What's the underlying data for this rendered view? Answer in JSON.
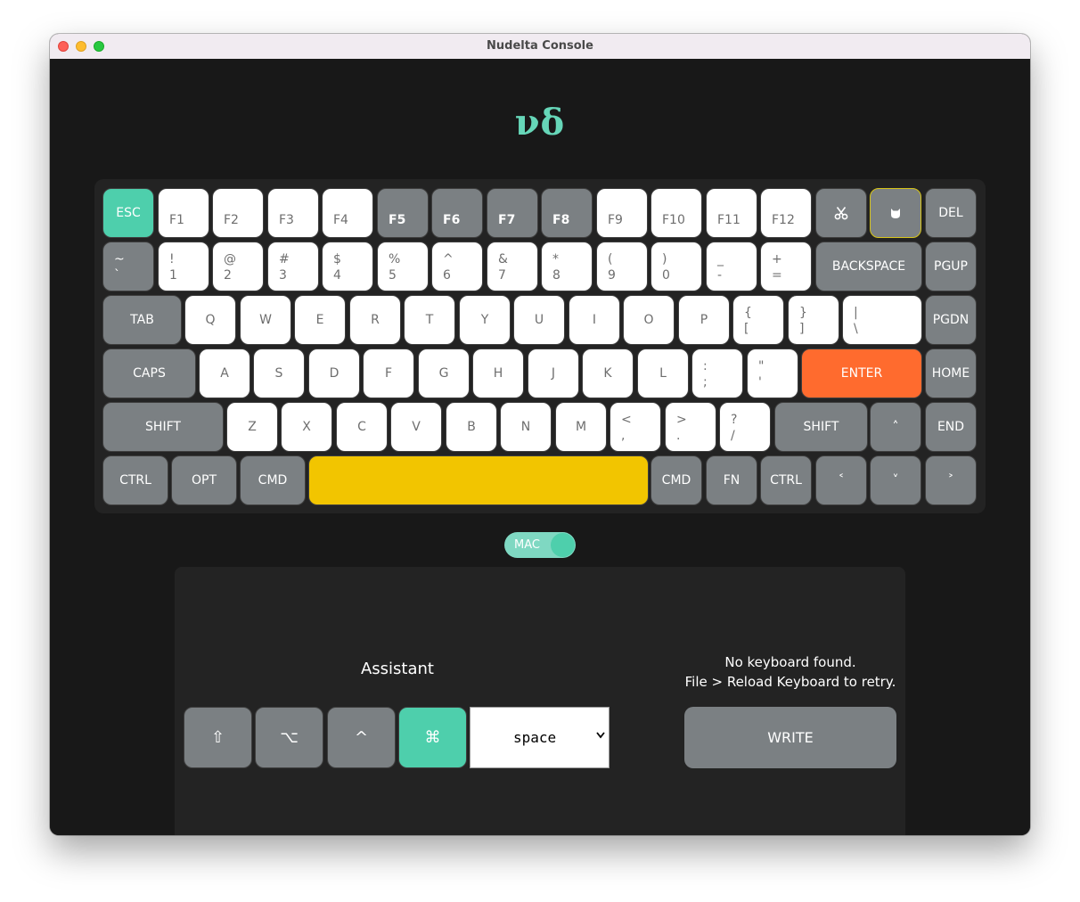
{
  "window": {
    "title": "Nudelta Console"
  },
  "logo": {
    "text": "νδ"
  },
  "keyboard": {
    "row0": {
      "esc": "ESC",
      "f1": "F1",
      "f2": "F2",
      "f3": "F3",
      "f4": "F4",
      "f5": "F5",
      "f6": "F6",
      "f7": "F7",
      "f8": "F8",
      "f9": "F9",
      "f10": "F10",
      "f11": "F11",
      "f12": "F12",
      "del": "DEL"
    },
    "row1": {
      "grave": [
        "~",
        "`"
      ],
      "k1": [
        "!",
        "1"
      ],
      "k2": [
        "@",
        "2"
      ],
      "k3": [
        "#",
        "3"
      ],
      "k4": [
        "$",
        "4"
      ],
      "k5": [
        "%",
        "5"
      ],
      "k6": [
        "^",
        "6"
      ],
      "k7": [
        "&",
        "7"
      ],
      "k8": [
        "*",
        "8"
      ],
      "k9": [
        "(",
        "9"
      ],
      "k0": [
        ")",
        "0"
      ],
      "minus": [
        "_",
        "-"
      ],
      "equals": [
        "+",
        "="
      ],
      "backspace": "BACKSPACE",
      "pgup": "PGUP"
    },
    "row2": {
      "tab": "TAB",
      "q": "Q",
      "w": "W",
      "e": "E",
      "r": "R",
      "t": "T",
      "y": "Y",
      "u": "U",
      "i": "I",
      "o": "O",
      "p": "P",
      "lbracket": [
        "{",
        "["
      ],
      "rbracket": [
        "}",
        "]"
      ],
      "backslash": [
        "|",
        "\\"
      ],
      "pgdn": "PGDN"
    },
    "row3": {
      "caps": "CAPS",
      "a": "A",
      "s": "S",
      "d": "D",
      "f": "F",
      "g": "G",
      "h": "H",
      "j": "J",
      "k": "K",
      "l": "L",
      "semicolon": [
        ":",
        ";"
      ],
      "quote": [
        "\"",
        "'"
      ],
      "enter": "ENTER",
      "home": "HOME"
    },
    "row4": {
      "lshift": "SHIFT",
      "z": "Z",
      "x": "X",
      "c": "C",
      "v": "V",
      "b": "B",
      "n": "N",
      "m": "M",
      "comma": [
        "<",
        ","
      ],
      "period": [
        ">",
        "."
      ],
      "slash": [
        "?",
        "/"
      ],
      "rshift": "SHIFT",
      "up": "˄",
      "end": "END"
    },
    "row5": {
      "lctrl": "CTRL",
      "opt": "OPT",
      "lcmd": "CMD",
      "rcmd": "CMD",
      "fn": "FN",
      "rctrl": "CTRL",
      "left": "˂",
      "down": "˅",
      "right": "˃"
    }
  },
  "mode_toggle": {
    "label": "MAC",
    "state": "on"
  },
  "assistant": {
    "title": "Assistant",
    "modifiers": {
      "shift": "⇧",
      "option": "⌥",
      "control": "^",
      "command": "⌘"
    },
    "key_select": {
      "value": "space"
    }
  },
  "status": {
    "line1": "No keyboard found.",
    "line2": "File > Reload Keyboard to retry."
  },
  "write_button": {
    "label": "WRITE"
  },
  "colors": {
    "accent": "#4ecfac",
    "enter": "#ff6b2e",
    "space": "#f2c500",
    "dark_key": "#7b8083"
  }
}
